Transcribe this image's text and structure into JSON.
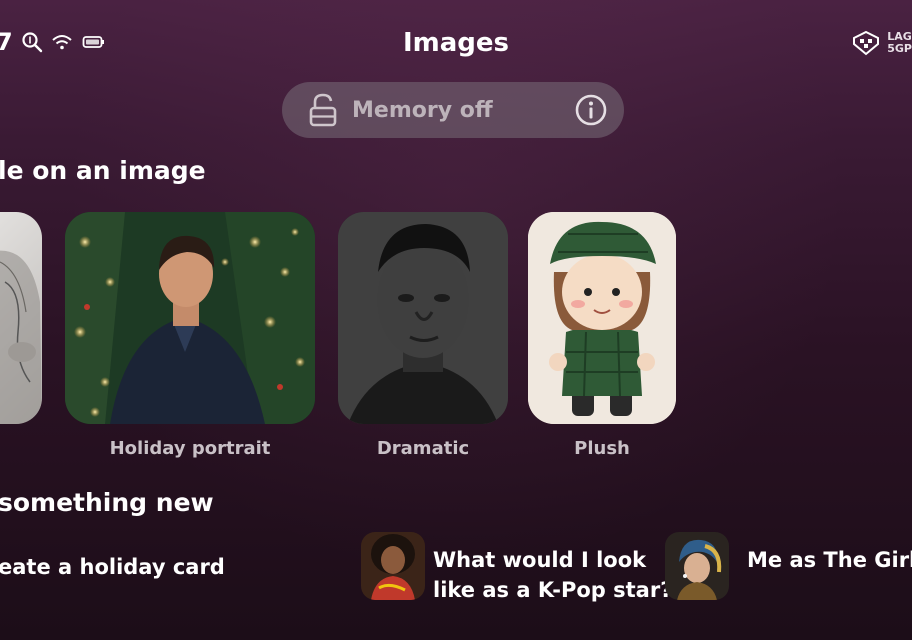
{
  "status_bar": {
    "time": "7",
    "carrier_line1": "LAG",
    "carrier_line2": "5GP",
    "icons": [
      "search-icon",
      "wifi-icon",
      "battery-icon",
      "network-icon"
    ]
  },
  "header": {
    "title": "Images"
  },
  "memory": {
    "label": "Memory off",
    "icons": [
      "unlock-icon",
      "info-icon"
    ]
  },
  "styles_section": {
    "title": "le on an image",
    "cards": [
      {
        "label": ""
      },
      {
        "label": "Holiday portrait"
      },
      {
        "label": "Dramatic"
      },
      {
        "label": "Plush"
      }
    ]
  },
  "new_section": {
    "title": "something new",
    "suggestions": [
      {
        "line1": "eate a holiday card",
        "line2": ""
      },
      {
        "line1": "What would I look",
        "line2": "like as a K-Pop star?"
      },
      {
        "line1": "Me as The Girl w",
        "line2": ""
      }
    ]
  },
  "colors": {
    "background": "#2a1224",
    "pill": "#6e646c",
    "muted_text": "#c9c1c7"
  }
}
